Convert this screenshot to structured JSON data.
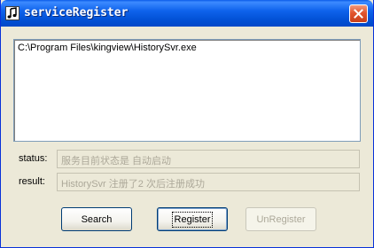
{
  "window": {
    "title": "serviceRegister",
    "icon": "music-note-icon",
    "close_icon": "close-icon"
  },
  "main": {
    "path_text": "C:\\Program Files\\kingview\\HistorySvr.exe",
    "status_label": "status:",
    "status_value": "服务目前状态是 自动启动",
    "result_label": "result:",
    "result_value": "HistorySvr 注册了2 次后注册成功"
  },
  "buttons": {
    "search_label": "Search",
    "register_label": "Register",
    "unregister_label": "UnRegister"
  },
  "colors": {
    "title_bar": "#0a5ce8",
    "dialog_face": "#ece9d8",
    "close_button": "#e2552e",
    "disabled_text": "#aca899"
  }
}
